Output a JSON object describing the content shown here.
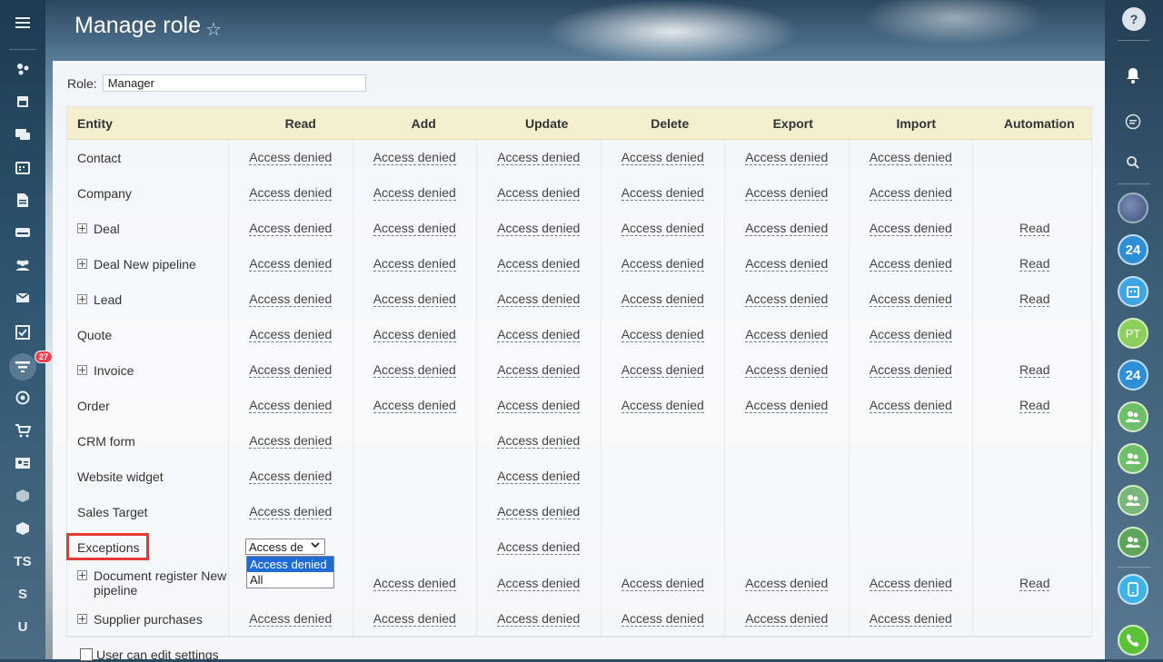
{
  "page": {
    "title": "Manage role"
  },
  "role": {
    "label": "Role:",
    "value": "Manager"
  },
  "table": {
    "headers": [
      "Entity",
      "Read",
      "Add",
      "Update",
      "Delete",
      "Export",
      "Import",
      "Automation"
    ],
    "rows": [
      {
        "entity": "Contact",
        "expandable": false,
        "cells": [
          "Access denied",
          "Access denied",
          "Access denied",
          "Access denied",
          "Access denied",
          "Access denied",
          ""
        ]
      },
      {
        "entity": "Company",
        "expandable": false,
        "cells": [
          "Access denied",
          "Access denied",
          "Access denied",
          "Access denied",
          "Access denied",
          "Access denied",
          ""
        ]
      },
      {
        "entity": "Deal",
        "expandable": true,
        "cells": [
          "Access denied",
          "Access denied",
          "Access denied",
          "Access denied",
          "Access denied",
          "Access denied",
          "Read"
        ]
      },
      {
        "entity": "Deal New pipeline",
        "expandable": true,
        "cells": [
          "Access denied",
          "Access denied",
          "Access denied",
          "Access denied",
          "Access denied",
          "Access denied",
          "Read"
        ]
      },
      {
        "entity": "Lead",
        "expandable": true,
        "cells": [
          "Access denied",
          "Access denied",
          "Access denied",
          "Access denied",
          "Access denied",
          "Access denied",
          "Read"
        ]
      },
      {
        "entity": "Quote",
        "expandable": false,
        "cells": [
          "Access denied",
          "Access denied",
          "Access denied",
          "Access denied",
          "Access denied",
          "Access denied",
          ""
        ]
      },
      {
        "entity": "Invoice",
        "expandable": true,
        "cells": [
          "Access denied",
          "Access denied",
          "Access denied",
          "Access denied",
          "Access denied",
          "Access denied",
          "Read"
        ]
      },
      {
        "entity": "Order",
        "expandable": false,
        "cells": [
          "Access denied",
          "Access denied",
          "Access denied",
          "Access denied",
          "Access denied",
          "Access denied",
          "Read"
        ]
      },
      {
        "entity": "CRM form",
        "expandable": false,
        "cells": [
          "Access denied",
          "",
          "Access denied",
          "",
          "",
          "",
          ""
        ]
      },
      {
        "entity": "Website widget",
        "expandable": false,
        "cells": [
          "Access denied",
          "",
          "Access denied",
          "",
          "",
          "",
          ""
        ]
      },
      {
        "entity": "Sales Target",
        "expandable": false,
        "cells": [
          "Access denied",
          "",
          "Access denied",
          "",
          "",
          "",
          ""
        ]
      },
      {
        "entity": "Exceptions",
        "expandable": false,
        "cells": [
          "",
          "",
          "Access denied",
          "",
          "",
          "",
          ""
        ]
      },
      {
        "entity": "Document register New pipeline",
        "expandable": true,
        "cells": [
          "",
          "Access denied",
          "Access denied",
          "Access denied",
          "Access denied",
          "Access denied",
          "Read"
        ]
      },
      {
        "entity": "Supplier purchases",
        "expandable": true,
        "cells": [
          "Access denied",
          "Access denied",
          "Access denied",
          "Access denied",
          "Access denied",
          "Access denied",
          ""
        ]
      }
    ]
  },
  "exceptions_select": {
    "value": "Access de",
    "options": [
      "Access denied",
      "All"
    ],
    "selected_index": 0
  },
  "footer": {
    "checkbox_label": "User can edit settings"
  },
  "left_sidebar": {
    "badge_count": "27",
    "text_items": [
      "TS",
      "S",
      "U"
    ]
  },
  "right_sidebar": {
    "items": [
      "?",
      "24",
      "PT",
      "24"
    ]
  },
  "colors": {
    "header_bg": "#f3efcf",
    "highlight": "#e53935",
    "selected_option": "#1e6ad6",
    "badge": "#f2414c"
  }
}
